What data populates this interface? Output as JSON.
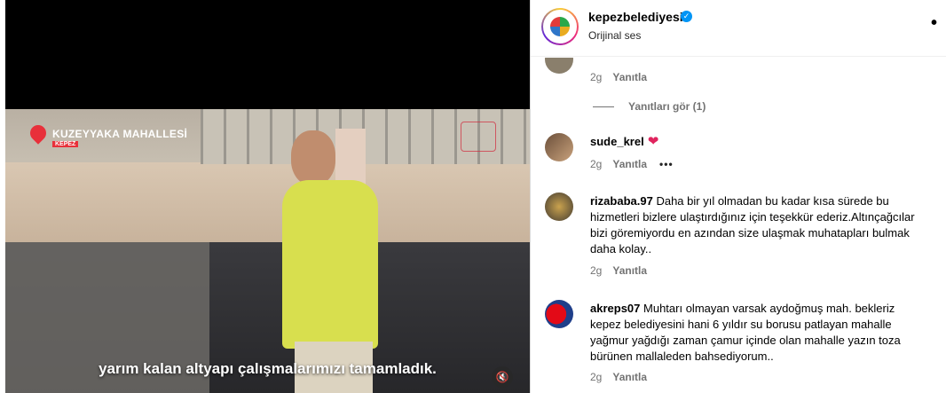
{
  "video": {
    "location_title": "KUZEYYAKA MAHALLESİ",
    "location_sub": "KEPEZ",
    "subtitle": "yarım kalan altyapı çalışmalarımızı tamamladık.",
    "mute_icon": "speaker-muted-icon"
  },
  "post": {
    "username": "kepezbelediyesi",
    "verified_icon": "verified-badge-icon",
    "audio": "Orijinal ses",
    "more": "•"
  },
  "comments": [
    {
      "username": "",
      "text": "",
      "time": "2g",
      "reply_label": "Yanıtla",
      "view_replies": "Yanıtları gör (1)"
    },
    {
      "username": "sude_krel",
      "text": "",
      "emoji": "❤",
      "time": "2g",
      "reply_label": "Yanıtla",
      "options": "•••"
    },
    {
      "username": "rizababa.97",
      "text": "Daha bir yıl olmadan bu kadar kısa sürede bu hizmetleri bizlere ulaştırdığınız için teşekkür ederiz.Altınçağcılar bizi göremiyordu en azından size ulaşmak muhatapları bulmak daha kolay..",
      "time": "2g",
      "reply_label": "Yanıtla"
    },
    {
      "username": "akreps07",
      "text": "Muhtarı olmayan varsak aydoğmuş mah. bekleriz kepez belediyesini hani 6 yıldır su borusu patlayan mahalle yağmur yağdığı zaman çamur içinde olan mahalle yazın toza bürünen mallaleden bahsediyorum..",
      "time": "2g",
      "reply_label": "Yanıtla"
    }
  ],
  "colors": {
    "accent_red": "#e8303a",
    "verified_blue": "#0095f6",
    "muted_text": "#737373",
    "vest": "#d8df4e"
  }
}
